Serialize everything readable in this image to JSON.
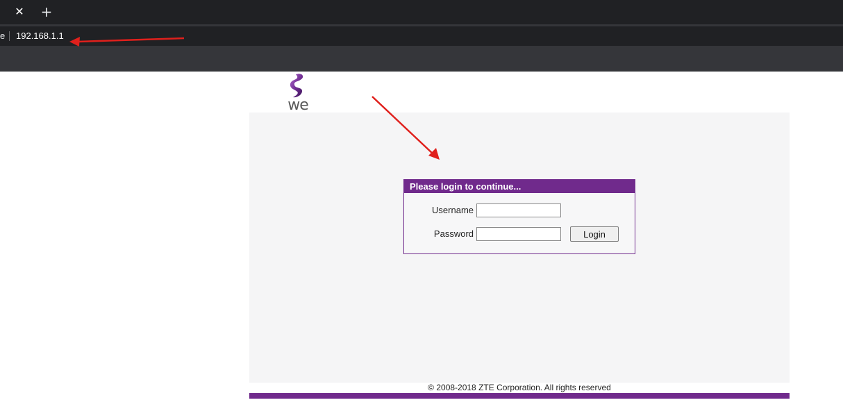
{
  "browser": {
    "close_tab_glyph": "✕",
    "new_tab_glyph": "+",
    "omnibox_prefix": "e",
    "url": "192.168.1.1"
  },
  "logo": {
    "text": "we",
    "icon": "we-logo-icon"
  },
  "login": {
    "header": "Please login to continue...",
    "username_label": "Username",
    "username_value": "",
    "password_label": "Password",
    "password_value": "",
    "login_button": "Login"
  },
  "footer": {
    "copyright": "© 2008-2018 ZTE Corporation. All rights reserved"
  },
  "colors": {
    "brand": "#702a8c",
    "annotation_arrow": "#e0201c"
  },
  "annotations": {
    "icon": "red-arrow-icon"
  }
}
